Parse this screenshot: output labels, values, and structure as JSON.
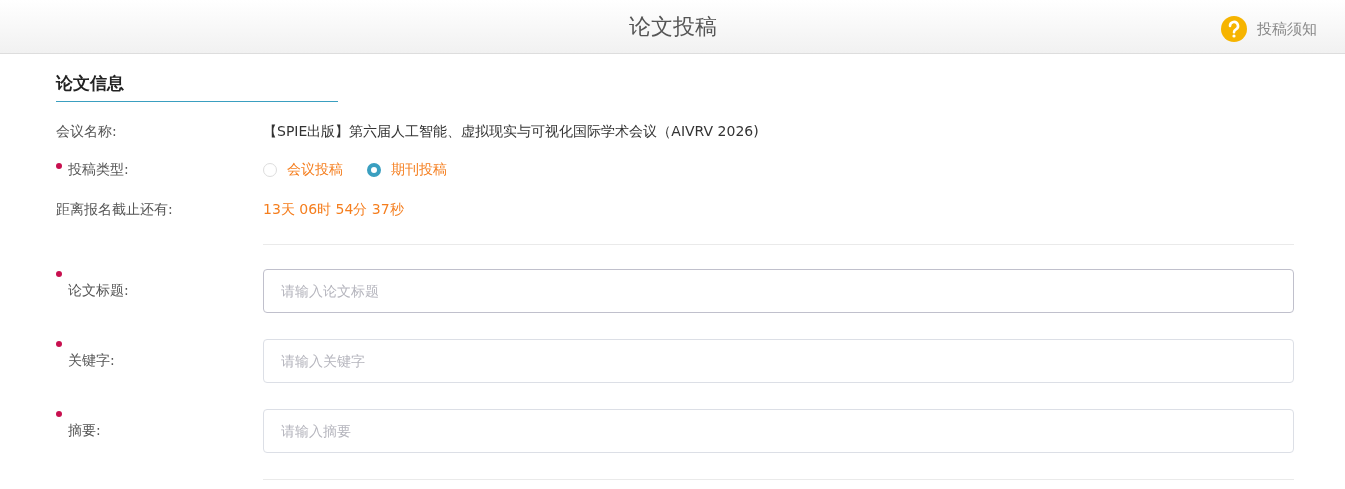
{
  "header": {
    "title": "论文投稿",
    "help_link": "投稿须知"
  },
  "section": {
    "title": "论文信息"
  },
  "info_rows": [
    {
      "kind": "text",
      "label": "会议名称:",
      "required": false,
      "value": "【SPIE出版】第六届人工智能、虚拟现实与可视化国际学术会议（AIVRV 2026)"
    },
    {
      "kind": "radio",
      "label": "投稿类型:",
      "required": true,
      "options": [
        {
          "label": "会议投稿",
          "selected": false
        },
        {
          "label": "期刊投稿",
          "selected": true
        }
      ]
    },
    {
      "kind": "countdown",
      "label": "距离报名截止还有:",
      "required": false,
      "value": "13天 06时 54分 37秒"
    }
  ],
  "fields": [
    {
      "label": "论文标题:",
      "required": true,
      "placeholder": "请输入论文标题",
      "focused": true
    },
    {
      "label": "关键字:",
      "required": true,
      "placeholder": "请输入关键字",
      "focused": false
    },
    {
      "label": "摘要:",
      "required": true,
      "placeholder": "请输入摘要",
      "focused": false
    }
  ]
}
